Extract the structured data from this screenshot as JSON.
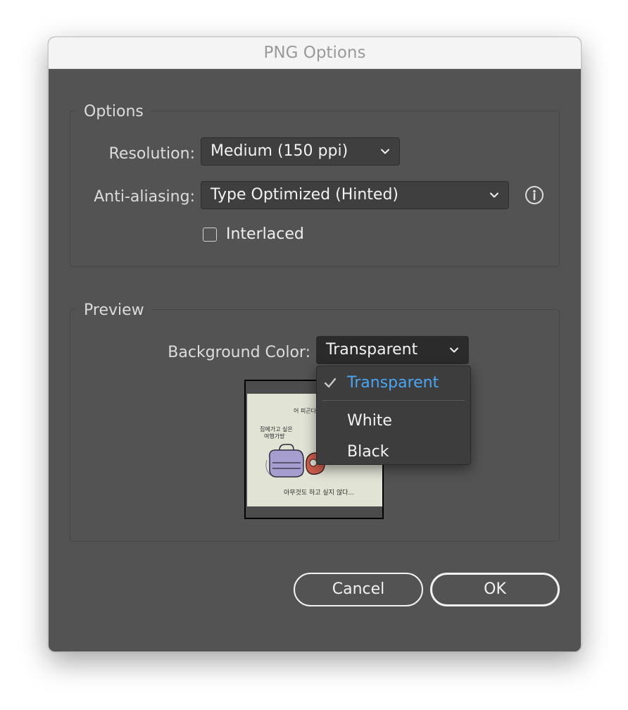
{
  "window": {
    "title": "PNG Options"
  },
  "options_group": {
    "label": "Options",
    "resolution": {
      "label": "Resolution:",
      "value": "Medium (150 ppi)"
    },
    "anti_aliasing": {
      "label": "Anti-aliasing:",
      "value": "Type Optimized (Hinted)",
      "info_icon": "info-icon"
    },
    "interlaced": {
      "label": "Interlaced",
      "checked": false
    }
  },
  "preview_group": {
    "label": "Preview",
    "background_color": {
      "label": "Background Color:",
      "value": "Transparent",
      "menu_open": true,
      "options": [
        {
          "label": "Transparent",
          "selected": true
        },
        {
          "label": "White",
          "selected": false
        },
        {
          "label": "Black",
          "selected": false
        }
      ]
    },
    "thumbnail_text": {
      "top_right": "어 피곤다.",
      "left": "집에가고 싶은",
      "left2": "여행가방",
      "caption": "아무것도 하고 싶지 않다..."
    }
  },
  "buttons": {
    "cancel": "Cancel",
    "ok": "OK"
  },
  "colors": {
    "dialog_bg": "#535353",
    "selected_text": "#4aa6f2"
  }
}
